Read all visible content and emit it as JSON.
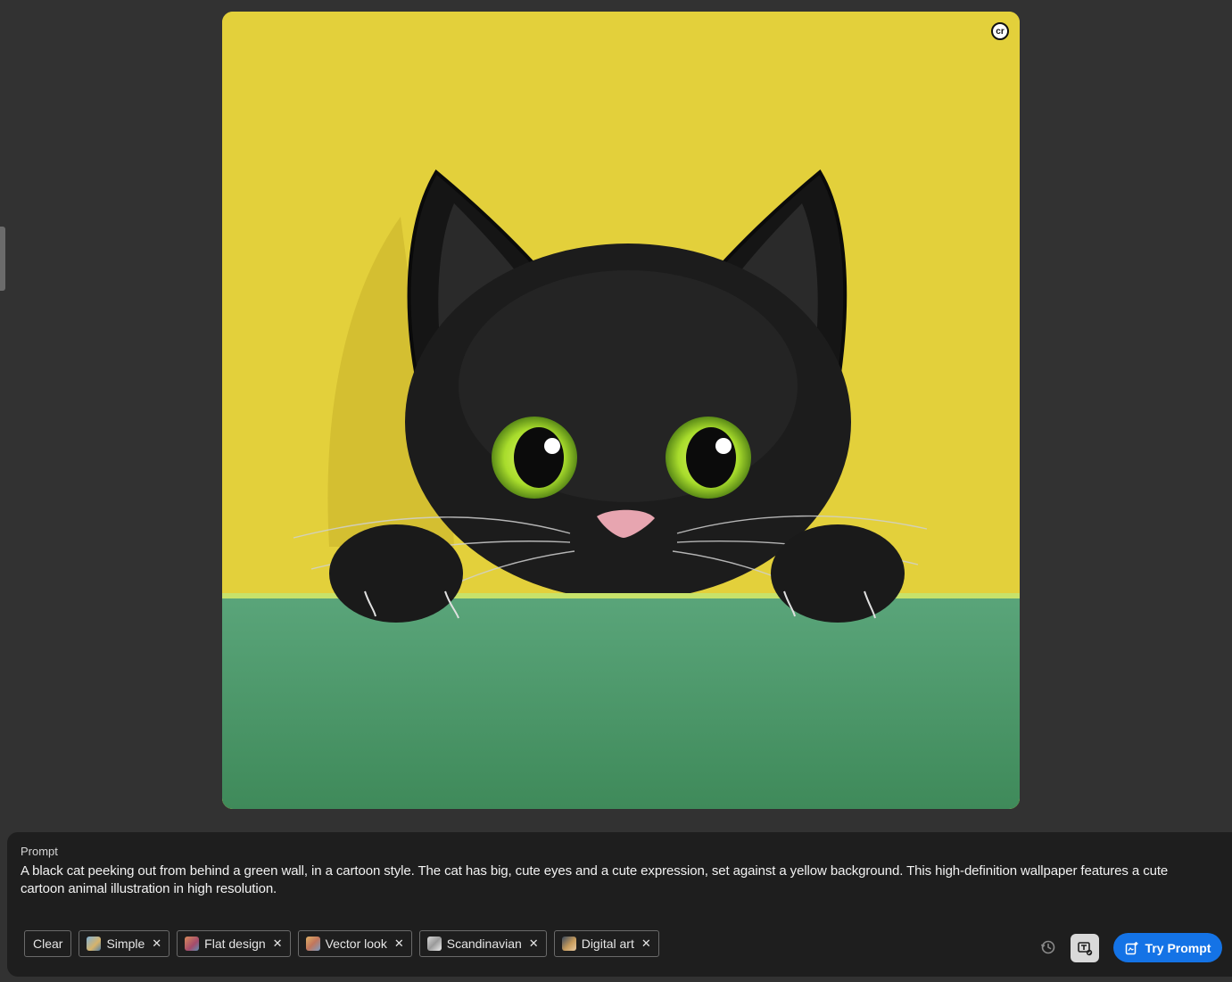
{
  "image": {
    "alt_badge": "cr",
    "colors": {
      "background": "#e2cf3a",
      "wall": "#4f9b6a",
      "cat": "#1a1a1a",
      "eyes": "#b8e23a"
    }
  },
  "prompt": {
    "label": "Prompt",
    "text": "A black cat peeking out from behind a green wall, in a cartoon style. The cat has big, cute eyes and a cute expression, set against a yellow background. This high-definition wallpaper features a cute cartoon animal illustration in high resolution."
  },
  "actions": {
    "clear_label": "Clear",
    "try_label": "Try Prompt"
  },
  "style_chips": [
    {
      "label": "Simple",
      "thumb": "simple"
    },
    {
      "label": "Flat design",
      "thumb": "flat"
    },
    {
      "label": "Vector look",
      "thumb": "vector"
    },
    {
      "label": "Scandinavian",
      "thumb": "scand"
    },
    {
      "label": "Digital art",
      "thumb": "digital"
    }
  ],
  "icons": {
    "history": "history-icon",
    "match": "match-style-icon",
    "try": "generate-icon",
    "remove": "close-icon"
  },
  "theme": {
    "accent": "#1473e6",
    "panel": "#1e1e1e",
    "page": "#323232"
  }
}
